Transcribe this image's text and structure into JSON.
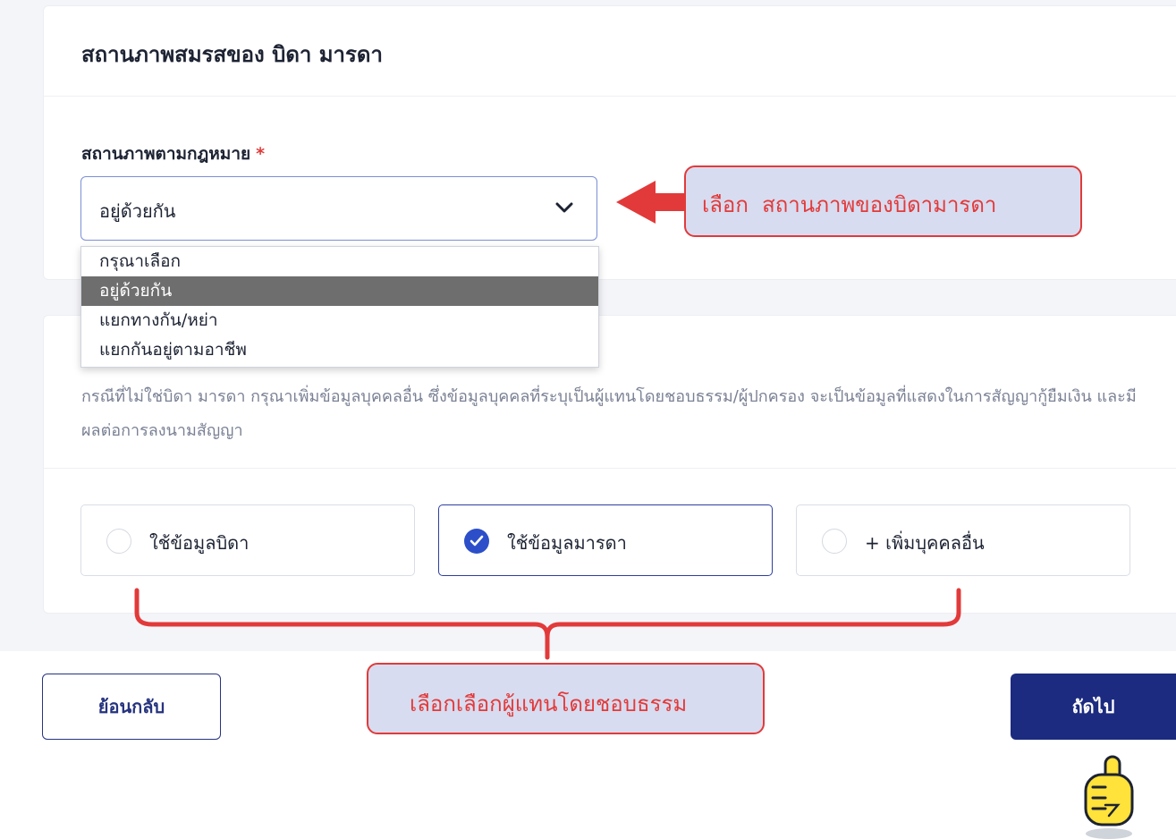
{
  "section_marital": {
    "title": "สถานภาพสมรสของ บิดา มารดา",
    "field_label": "สถานภาพตามกฎหมาย",
    "required_mark": "*",
    "selected_value": "อยู่ด้วยกัน",
    "options": [
      "กรุณาเลือก",
      "อยู่ด้วยกัน",
      "แยกทางกัน/หย่า",
      "แยกกันอยู่ตามอาชีพ"
    ]
  },
  "section_guardian": {
    "description": "กรณีที่ไม่ใช่บิดา มารดา กรุณาเพิ่มข้อมูลบุคคลอื่น ซึ่งข้อมูลบุคคลที่ระบุเป็นผู้แทนโดยชอบธรรม/ผู้ปกครอง จะเป็นข้อมูลที่แสดงในการสัญญากู้ยืมเงิน และมีผลต่อการลงนามสัญญา",
    "choices": [
      {
        "label": "ใช้ข้อมูลบิดา",
        "checked": false
      },
      {
        "label": "ใช้ข้อมูลมารดา",
        "checked": true
      },
      {
        "label": "+ เพิ่มบุคคลอื่น",
        "checked": false
      }
    ]
  },
  "buttons": {
    "back": "ย้อนกลับ",
    "next": "ถัดไป"
  },
  "annotations": {
    "callout_select": "เลือก  สถานภาพของบิดามารดา",
    "callout_guardian": "เลือกเลือกผู้แทนโดยชอบธรรม",
    "accent_color": "#e23a3a"
  },
  "icons": {
    "dropdown": "chevron-down-icon",
    "pointer": "pointing-hand-icon"
  }
}
